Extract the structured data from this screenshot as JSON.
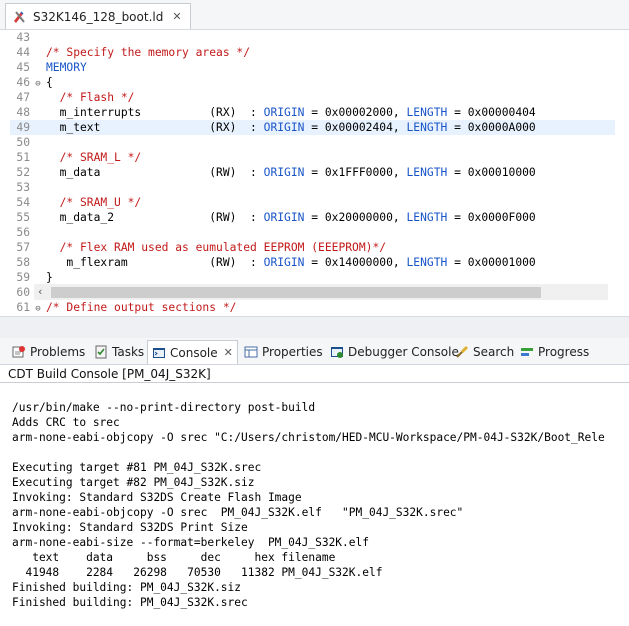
{
  "editor": {
    "tab_label": "S32K146_128_boot.ld",
    "tab_icon": "linker-script-icon",
    "lines": [
      {
        "n": "43",
        "fold": "",
        "parts": []
      },
      {
        "n": "44",
        "fold": "",
        "parts": [
          {
            "t": "/* Specify the memory areas */",
            "c": "cm"
          }
        ]
      },
      {
        "n": "45",
        "fold": "",
        "parts": [
          {
            "t": "MEMORY",
            "c": "kw"
          }
        ]
      },
      {
        "n": "46",
        "fold": "⊖",
        "parts": [
          {
            "t": "{",
            "c": ""
          }
        ]
      },
      {
        "n": "47",
        "fold": "",
        "parts": [
          {
            "t": "  /* Flash */",
            "c": "cm"
          }
        ]
      },
      {
        "n": "48",
        "fold": "",
        "parts": [
          {
            "t": "  m_interrupts          (RX)  : ",
            "c": ""
          },
          {
            "t": "ORIGIN",
            "c": "kw"
          },
          {
            "t": " = 0x00002000, ",
            "c": ""
          },
          {
            "t": "LENGTH",
            "c": "kw"
          },
          {
            "t": " = 0x00000404",
            "c": ""
          }
        ]
      },
      {
        "n": "49",
        "fold": "",
        "current": true,
        "parts": [
          {
            "t": "  m_text                (RX)  : ",
            "c": ""
          },
          {
            "t": "ORIGIN",
            "c": "kw"
          },
          {
            "t": " = 0x00002404, ",
            "c": ""
          },
          {
            "t": "LENGTH",
            "c": "kw"
          },
          {
            "t": " = 0x0000A000",
            "c": ""
          }
        ]
      },
      {
        "n": "50",
        "fold": "",
        "parts": []
      },
      {
        "n": "51",
        "fold": "",
        "parts": [
          {
            "t": "  /* SRAM_L */",
            "c": "cm"
          }
        ]
      },
      {
        "n": "52",
        "fold": "",
        "parts": [
          {
            "t": "  m_data                (RW)  : ",
            "c": ""
          },
          {
            "t": "ORIGIN",
            "c": "kw"
          },
          {
            "t": " = 0x1FFF0000, ",
            "c": ""
          },
          {
            "t": "LENGTH",
            "c": "kw"
          },
          {
            "t": " = 0x00010000",
            "c": ""
          }
        ]
      },
      {
        "n": "53",
        "fold": "",
        "parts": []
      },
      {
        "n": "54",
        "fold": "",
        "parts": [
          {
            "t": "  /* SRAM_U */",
            "c": "cm"
          }
        ]
      },
      {
        "n": "55",
        "fold": "",
        "parts": [
          {
            "t": "  m_data_2              (RW)  : ",
            "c": ""
          },
          {
            "t": "ORIGIN",
            "c": "kw"
          },
          {
            "t": " = 0x20000000, ",
            "c": ""
          },
          {
            "t": "LENGTH",
            "c": "kw"
          },
          {
            "t": " = 0x0000F000",
            "c": ""
          }
        ]
      },
      {
        "n": "56",
        "fold": "",
        "parts": []
      },
      {
        "n": "57",
        "fold": "",
        "parts": [
          {
            "t": "  /* Flex RAM used as eumulated EEPROM (EEEPROM)*/",
            "c": "cm"
          }
        ]
      },
      {
        "n": "58",
        "fold": "",
        "parts": [
          {
            "t": "   m_flexram            (RW)  : ",
            "c": ""
          },
          {
            "t": "ORIGIN",
            "c": "kw"
          },
          {
            "t": " = 0x14000000, ",
            "c": ""
          },
          {
            "t": "LENGTH",
            "c": "kw"
          },
          {
            "t": " = 0x00001000",
            "c": ""
          }
        ]
      },
      {
        "n": "59",
        "fold": "",
        "parts": [
          {
            "t": "}",
            "c": ""
          }
        ]
      },
      {
        "n": "60",
        "fold": "",
        "parts": []
      },
      {
        "n": "61",
        "fold": "⊖",
        "parts": [
          {
            "t": "/* Define output sections */",
            "c": "cm"
          }
        ]
      }
    ]
  },
  "panel": {
    "tabs": [
      {
        "id": "problems",
        "label": "Problems",
        "icon": "problems-icon",
        "active": false
      },
      {
        "id": "tasks",
        "label": "Tasks",
        "icon": "tasks-icon",
        "active": false
      },
      {
        "id": "console",
        "label": "Console",
        "icon": "console-icon",
        "active": true
      },
      {
        "id": "properties",
        "label": "Properties",
        "icon": "properties-icon",
        "active": false
      },
      {
        "id": "debugger-console",
        "label": "Debugger Console",
        "icon": "debugger-console-icon",
        "active": false
      },
      {
        "id": "search",
        "label": "Search",
        "icon": "search-icon",
        "active": false
      },
      {
        "id": "progress",
        "label": "Progress",
        "icon": "progress-icon",
        "active": false
      }
    ]
  },
  "console": {
    "title": "CDT Build Console [PM_04J_S32K]",
    "lines": [
      "/usr/bin/make --no-print-directory post-build",
      "Adds CRC to srec",
      "arm-none-eabi-objcopy -O srec \"C:/Users/christom/HED-MCU-Workspace/PM-04J-S32K/Boot_Rele",
      "",
      "Executing target #81 PM_04J_S32K.srec",
      "Executing target #82 PM_04J_S32K.siz",
      "Invoking: Standard S32DS Create Flash Image",
      "arm-none-eabi-objcopy -O srec  PM_04J_S32K.elf   \"PM_04J_S32K.srec\"",
      "Invoking: Standard S32DS Print Size",
      "arm-none-eabi-size --format=berkeley  PM_04J_S32K.elf",
      "   text    data     bss     dec     hex filename",
      "  41948    2284   26298   70530   11382 PM_04J_S32K.elf",
      "Finished building: PM_04J_S32K.siz",
      "Finished building: PM_04J_S32K.srec"
    ]
  }
}
